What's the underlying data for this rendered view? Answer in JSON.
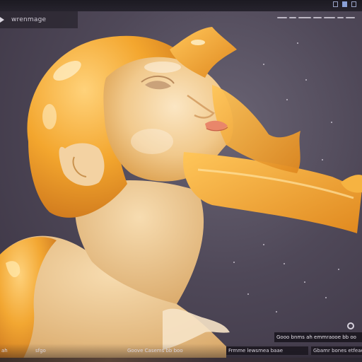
{
  "window": {
    "tab_label": "wrenmage"
  },
  "overlays": {
    "caption": "Gooo bnms ah emmraooe  bb oo",
    "footer_segments": [
      "ah",
      "sfgo",
      "Goove Casems bb boo",
      "Frmme lewsmea baae",
      "Gbamr bones etfeaet"
    ]
  },
  "icons": {
    "tab": "play-icon",
    "top_right": [
      "window-icon",
      "flag-icon",
      "panel-icon"
    ],
    "caption_side": "gear-icon"
  },
  "colors": {
    "background": "#4f4858",
    "sculpture_amber": "#f0a733",
    "skin_cream": "#f4d6a8"
  }
}
